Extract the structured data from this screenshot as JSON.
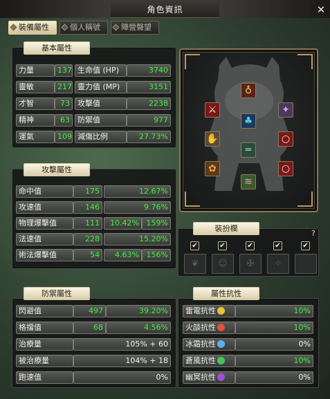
{
  "window": {
    "title": "角色資訊",
    "close": "✕"
  },
  "tabs": [
    {
      "label": "裝備屬性"
    },
    {
      "label": "個人稱號"
    },
    {
      "label": "陣營聲望"
    }
  ],
  "basic": {
    "title": "基本屬性",
    "rows": [
      {
        "l1": "力量",
        "v1": "137",
        "l2": "生命值 (HP)",
        "v2": "3740"
      },
      {
        "l1": "靈敏",
        "v1": "217",
        "l2": "靈力值 (MP)",
        "v2": "3151"
      },
      {
        "l1": "才智",
        "v1": "73",
        "l2": "攻擊值",
        "v2": "2238"
      },
      {
        "l1": "精神",
        "v1": "63",
        "l2": "防禦值",
        "v2": "977"
      },
      {
        "l1": "運氣",
        "v1": "109",
        "l2": "減傷比例",
        "v2": "27.73%"
      }
    ]
  },
  "attack": {
    "title": "攻擊屬性",
    "rows": [
      {
        "label": "命中值",
        "value": "175",
        "pct": "12.67%"
      },
      {
        "label": "攻速值",
        "value": "146",
        "pct": "9.76%"
      },
      {
        "label": "物理爆擊值",
        "value": "111",
        "pct": "10.42%",
        "mult": "159%"
      },
      {
        "label": "法速值",
        "value": "228",
        "pct": "15.20%"
      },
      {
        "label": "術法爆擊值",
        "value": "54",
        "pct": "4.63%",
        "mult": "156%"
      }
    ]
  },
  "costume": {
    "title": "裝扮欄",
    "help": "?",
    "checks": [
      "✔",
      "✔",
      "✔",
      "✔",
      "✔"
    ]
  },
  "defense": {
    "title": "防禦屬性",
    "rows": [
      {
        "label": "閃避值",
        "value": "497",
        "pct": "39.20%"
      },
      {
        "label": "格擋值",
        "value": "68",
        "pct": "4.56%"
      },
      {
        "label": "治療量",
        "combo": "105% + 60"
      },
      {
        "label": "被治療量",
        "combo": "104% + 18"
      },
      {
        "label": "跑速值",
        "combo": "0%"
      }
    ]
  },
  "resist": {
    "title": "屬性抗性",
    "rows": [
      {
        "label": "雷電抗性",
        "value": "10%",
        "color": "#e8c23a",
        "icon": "lightning-icon"
      },
      {
        "label": "火燄抗性",
        "value": "10%",
        "color": "#e0503a",
        "icon": "fire-icon"
      },
      {
        "label": "冰霜抗性",
        "value": "0%",
        "color": "#5ab0f0",
        "icon": "ice-icon"
      },
      {
        "label": "蒼風抗性",
        "value": "10%",
        "color": "#4ac05a",
        "icon": "wind-icon"
      },
      {
        "label": "幽冥抗性",
        "value": "0%",
        "color": "#a050d8",
        "icon": "dark-icon"
      }
    ]
  }
}
